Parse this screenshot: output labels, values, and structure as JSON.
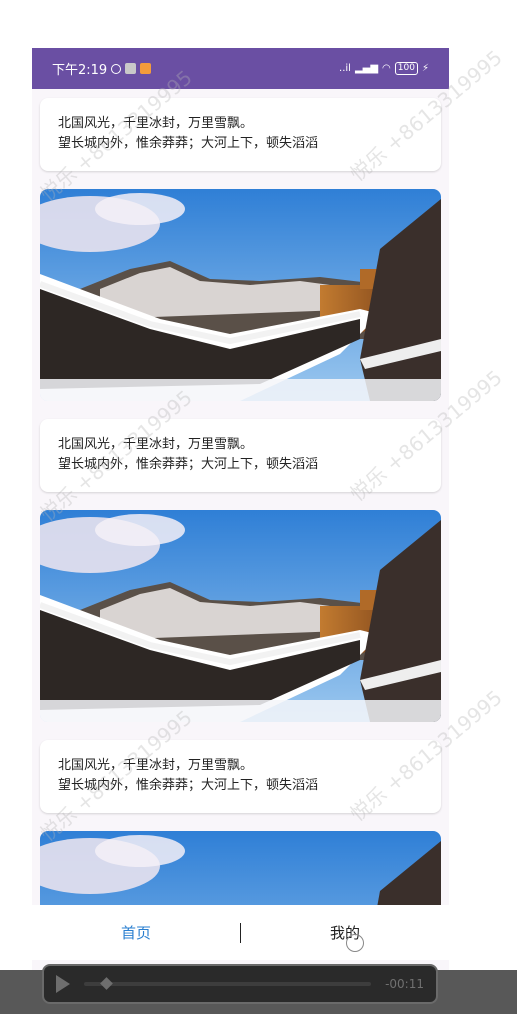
{
  "status_bar": {
    "time": "下午2:19",
    "network": "..il",
    "battery": "100"
  },
  "feed": {
    "caption_line1": "北国风光，千里冰封，万里雪飘。",
    "caption_line2": "望长城内外，惟余莽莽；大河上下，顿失滔滔"
  },
  "tabs": [
    {
      "label": "首页"
    },
    {
      "label": "我的"
    }
  ],
  "player": {
    "time": "-00:11",
    "progress": 0.05
  },
  "watermark": {
    "text1": "悦乐",
    "text2": "+8613319995"
  },
  "colors": {
    "status_bar": "#6a4fa3",
    "active_tab": "#2a7fd0"
  }
}
